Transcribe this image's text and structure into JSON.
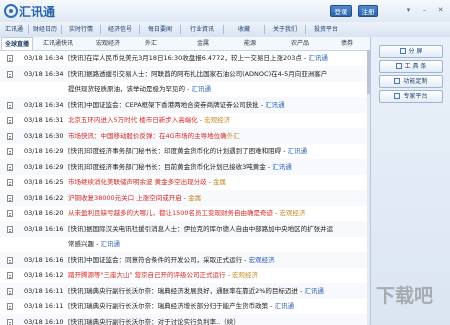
{
  "app": {
    "name": "汇讯通",
    "login": "登录",
    "register": "注册",
    "controls": [
      "▾",
      "–",
      "✕"
    ]
  },
  "nav": [
    "汇讯通",
    "财经日历",
    "实时行情",
    "经济信号",
    "每日要闻",
    "行业資讯",
    "收藏",
    "关于我们",
    "投资平台"
  ],
  "categories": [
    "全球直播",
    "汇讯通快讯",
    "宏观经济",
    "外汇",
    "金属",
    "能源",
    "农产品",
    "债券"
  ],
  "sidebar": {
    "buttons": [
      "分  屏",
      "工 具 条",
      "功能定制",
      "专家平台"
    ]
  },
  "watermark": "下载吧",
  "news": [
    {
      "time": "03/18 16:34",
      "title": "[快讯]在岸人民币兑美元3月18日16:30收盘报6.4772，较上一交易日上涨203点 - ",
      "source": "汇讯通",
      "color": "#222222"
    },
    {
      "time": "03/18 16:34",
      "title": "[快讯]据路透援引交易人士：阿联酋的阿布扎比国家石油公司(ADNOC)在4-5月向亚洲客户",
      "source": "",
      "color": "#222222"
    },
    {
      "time": "",
      "title": "提供现货轻质原油，该举动是极为罕见的 - ",
      "source": "汇讯通",
      "color": "#222222"
    },
    {
      "time": "03/18 16:34",
      "title": "[快讯]中国证监会：CEPA框架下香港两地合资券商牌证券公司获批 - ",
      "source": "汇讯通",
      "color": "#222222"
    },
    {
      "time": "03/18 16:31",
      "title": "北京五环内进入5万时代 楼市日新步入高端化 - ",
      "source": "宏观经济",
      "color": "#d62626"
    },
    {
      "time": "03/18 16:30",
      "title": "市场快讯：中国移动股价反弹：在4G市场的主导地位确",
      "source": "外汇",
      "color": "#d62626"
    },
    {
      "time": "03/18 16:29",
      "title": "[快讯]印度经济事务部门秘书长：印度黄金货币化的计划遇到了困难和阻碍 - ",
      "source": "汇讯通",
      "color": "#222222"
    },
    {
      "time": "03/18 16:29",
      "title": "[快讯]印度经济事务部门秘书长：目前黄金货币化计划已接收3吨黄金 - ",
      "source": "汇讯通",
      "color": "#222222"
    },
    {
      "time": "03/18 16:25",
      "title": "市场继续消化美联储声明余波 黄金多空出现分歧 - ",
      "source": "金属",
      "color": "#d62626"
    },
    {
      "time": "03/18 16:22",
      "title": "沪铜收复38000元关口 上涨空间或开启 - ",
      "source": "金属",
      "color": "#d62626"
    },
    {
      "time": "03/18 16:20",
      "title": "从未盈利且缺亏越多的大哪儿，都让1500名员工变现财务自由确是奇迹 - ",
      "source": "宏观经济",
      "color": "#d62626"
    },
    {
      "time": "03/18 16:16",
      "title": "[快讯]据国际汉关电讯社援引消息人士：伊拉克的库尔德人自由中部路加中央地区的扩张并运",
      "source": "",
      "color": "#222222"
    },
    {
      "time": "",
      "title": "常感兴趣 - ",
      "source": "汇讯通",
      "color": "#222222"
    },
    {
      "time": "03/18 16:16",
      "title": "[快讯]中国证监会：同意符合条件的开发公司，采取正式运行 - ",
      "source": "宏观经济",
      "color": "#222222"
    },
    {
      "time": "03/18 16:12",
      "title": "踏开腾源等\"三座大山\" 营京自己开的评级公司正式运行 - ",
      "source": "宏观经济",
      "color": "#d62626"
    },
    {
      "time": "03/18 16:11",
      "title": "[快讯]瑞典央行副行长沃尔奈：瑞典经济发展良好，通胀率在靠近2%的目标迈进 - ",
      "source": "汇讯通",
      "color": "#222222"
    },
    {
      "time": "03/18 16:11",
      "title": "[快讯]瑞典央行副行长沃尔奈：瑞典经济增长部分归于能产生货币政策 - ",
      "source": "汇讯通",
      "color": "#222222"
    },
    {
      "time": "03/18 16:10",
      "title": "[快讯]瑞典央行副行长沃尔奈：对于讨论实行负利率..（续）",
      "source": "",
      "color": "#222222"
    }
  ]
}
